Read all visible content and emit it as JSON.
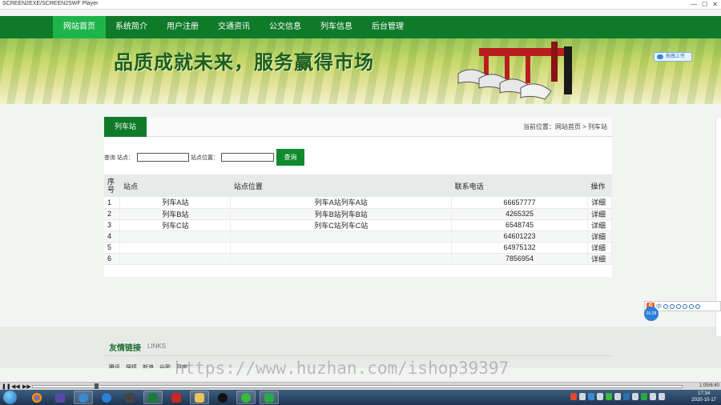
{
  "player": {
    "title": "SCREEN2EXE/SCREEN2SWF Player",
    "time_display": "1:05/6:40"
  },
  "nav": {
    "items": [
      {
        "label": "网站首页",
        "active": true
      },
      {
        "label": "系统简介",
        "active": false
      },
      {
        "label": "用户注册",
        "active": false
      },
      {
        "label": "交通资讯",
        "active": false
      },
      {
        "label": "公交信息",
        "active": false
      },
      {
        "label": "列车信息",
        "active": false
      },
      {
        "label": "后台管理",
        "active": false
      }
    ]
  },
  "banner": {
    "slogan": "品质成就未来，服务赢得市场",
    "upload_label": "拖拽上传"
  },
  "panel": {
    "tab_label": "列车站",
    "breadcrumb": "当前位置：网站首页 > 列车站"
  },
  "search": {
    "intro": "查询",
    "station_label": "站点：",
    "station_value": "",
    "location_label": "站点位置：",
    "location_value": "",
    "button_label": "查询"
  },
  "table": {
    "headers": {
      "no": "序号",
      "name": "站点",
      "location": "站点位置",
      "phone": "联系电话",
      "op": "操作"
    },
    "rows": [
      {
        "no": "1",
        "name": "列车A站",
        "location": "列车A站列车A站",
        "phone": "66657777",
        "op": "详细"
      },
      {
        "no": "2",
        "name": "列车B站",
        "location": "列车B站列车B站",
        "phone": "4265325",
        "op": "详细"
      },
      {
        "no": "3",
        "name": "列车C站",
        "location": "列车C站列车C站",
        "phone": "6548745",
        "op": "详细"
      },
      {
        "no": "4",
        "name": "",
        "location": "",
        "phone": "64601223",
        "op": "详细"
      },
      {
        "no": "5",
        "name": "",
        "location": "",
        "phone": "64975132",
        "op": "详细"
      },
      {
        "no": "6",
        "name": "",
        "location": "",
        "phone": "7856954",
        "op": "详细"
      }
    ]
  },
  "footer": {
    "links_title": "友情链接",
    "links_en": "LINKS",
    "links": [
      "腾讯",
      "搜狐",
      "新浪",
      "谷歌",
      "百度"
    ]
  },
  "watermark": "https://www.huzhan.com/ishop39397",
  "ime": {
    "logo": "S",
    "mode": "中"
  },
  "recorder_time": "01:28",
  "clock": {
    "time": "17:34",
    "date": "2020-10-17"
  },
  "colors": {
    "brand_green": "#0f7a2a",
    "active_green": "#1fb44a"
  }
}
